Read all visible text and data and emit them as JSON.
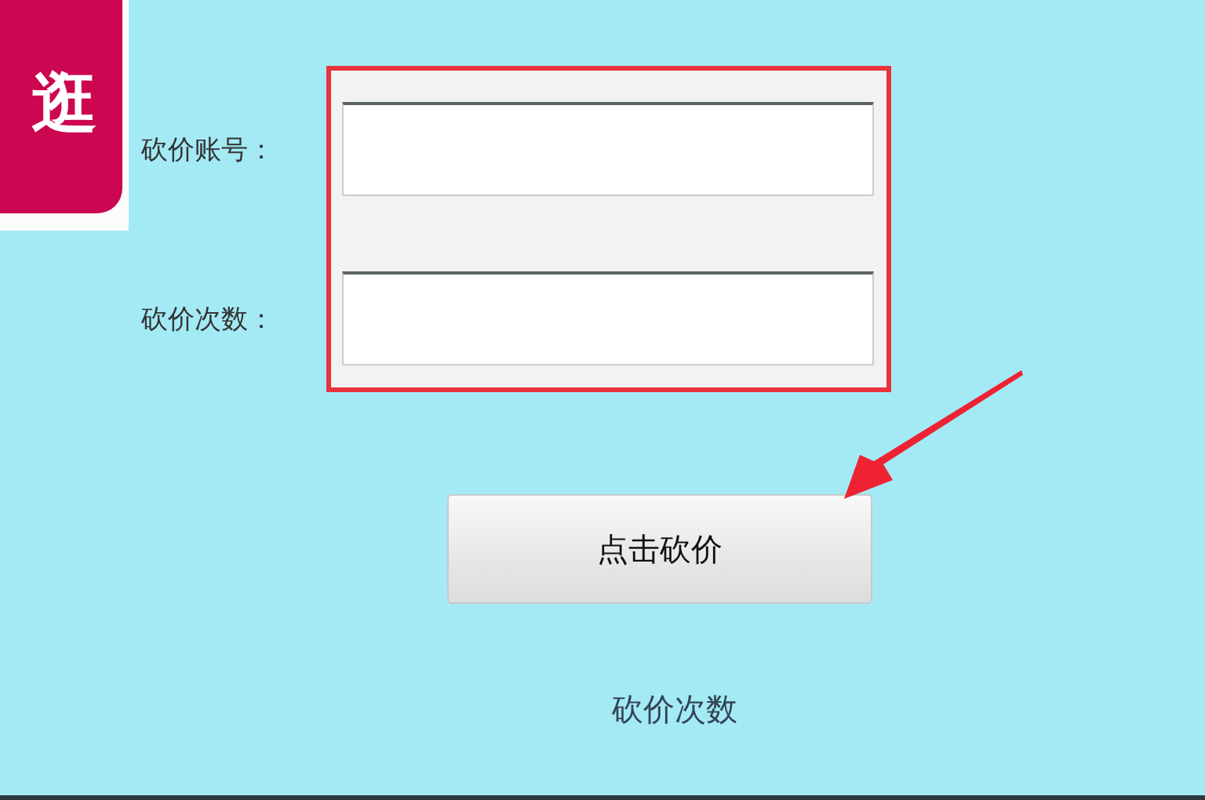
{
  "logo": {
    "text": "逛"
  },
  "fields": [
    {
      "label": "砍价账号："
    },
    {
      "label": "砍价次数："
    }
  ],
  "button": {
    "label": "点击砍价"
  },
  "footer_text": "砍价次数"
}
